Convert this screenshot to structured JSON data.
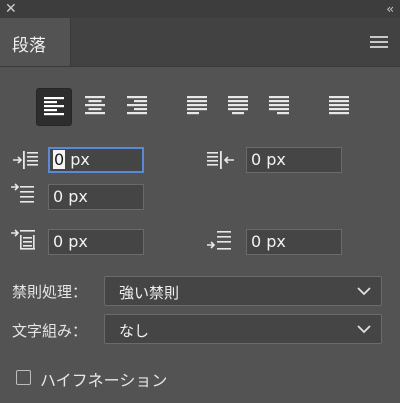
{
  "titlebar": {
    "close_glyph": "✕",
    "collapse_glyph": "‹‹"
  },
  "tab": {
    "label": "段落"
  },
  "alignment": {
    "buttons": [
      {
        "name": "align-left",
        "active": true
      },
      {
        "name": "align-center",
        "active": false
      },
      {
        "name": "align-right",
        "active": false
      },
      {
        "name": "justify-last-left",
        "active": false
      },
      {
        "name": "justify-last-center",
        "active": false
      },
      {
        "name": "justify-last-right",
        "active": false
      },
      {
        "name": "justify-all",
        "active": false
      }
    ]
  },
  "indents": {
    "left_indent": {
      "value_selected": "0",
      "value_rest": " px",
      "icon": "left-indent-icon"
    },
    "right_indent": {
      "value": "0 px",
      "icon": "right-indent-icon"
    },
    "first_line_indent": {
      "value": "0 px",
      "icon": "first-line-indent-icon"
    },
    "space_before": {
      "value": "0 px",
      "icon": "space-before-icon"
    },
    "space_after": {
      "value": "0 px",
      "icon": "space-after-icon"
    }
  },
  "kinsoku": {
    "label": "禁則処理：",
    "value": "強い禁則"
  },
  "mojikumi": {
    "label": "文字組み：",
    "value": "なし"
  },
  "hyphenation": {
    "label": "ハイフネーション",
    "checked": false
  },
  "colors": {
    "panel": "#535353",
    "focus": "#5a8ad6",
    "field": "#454545"
  }
}
